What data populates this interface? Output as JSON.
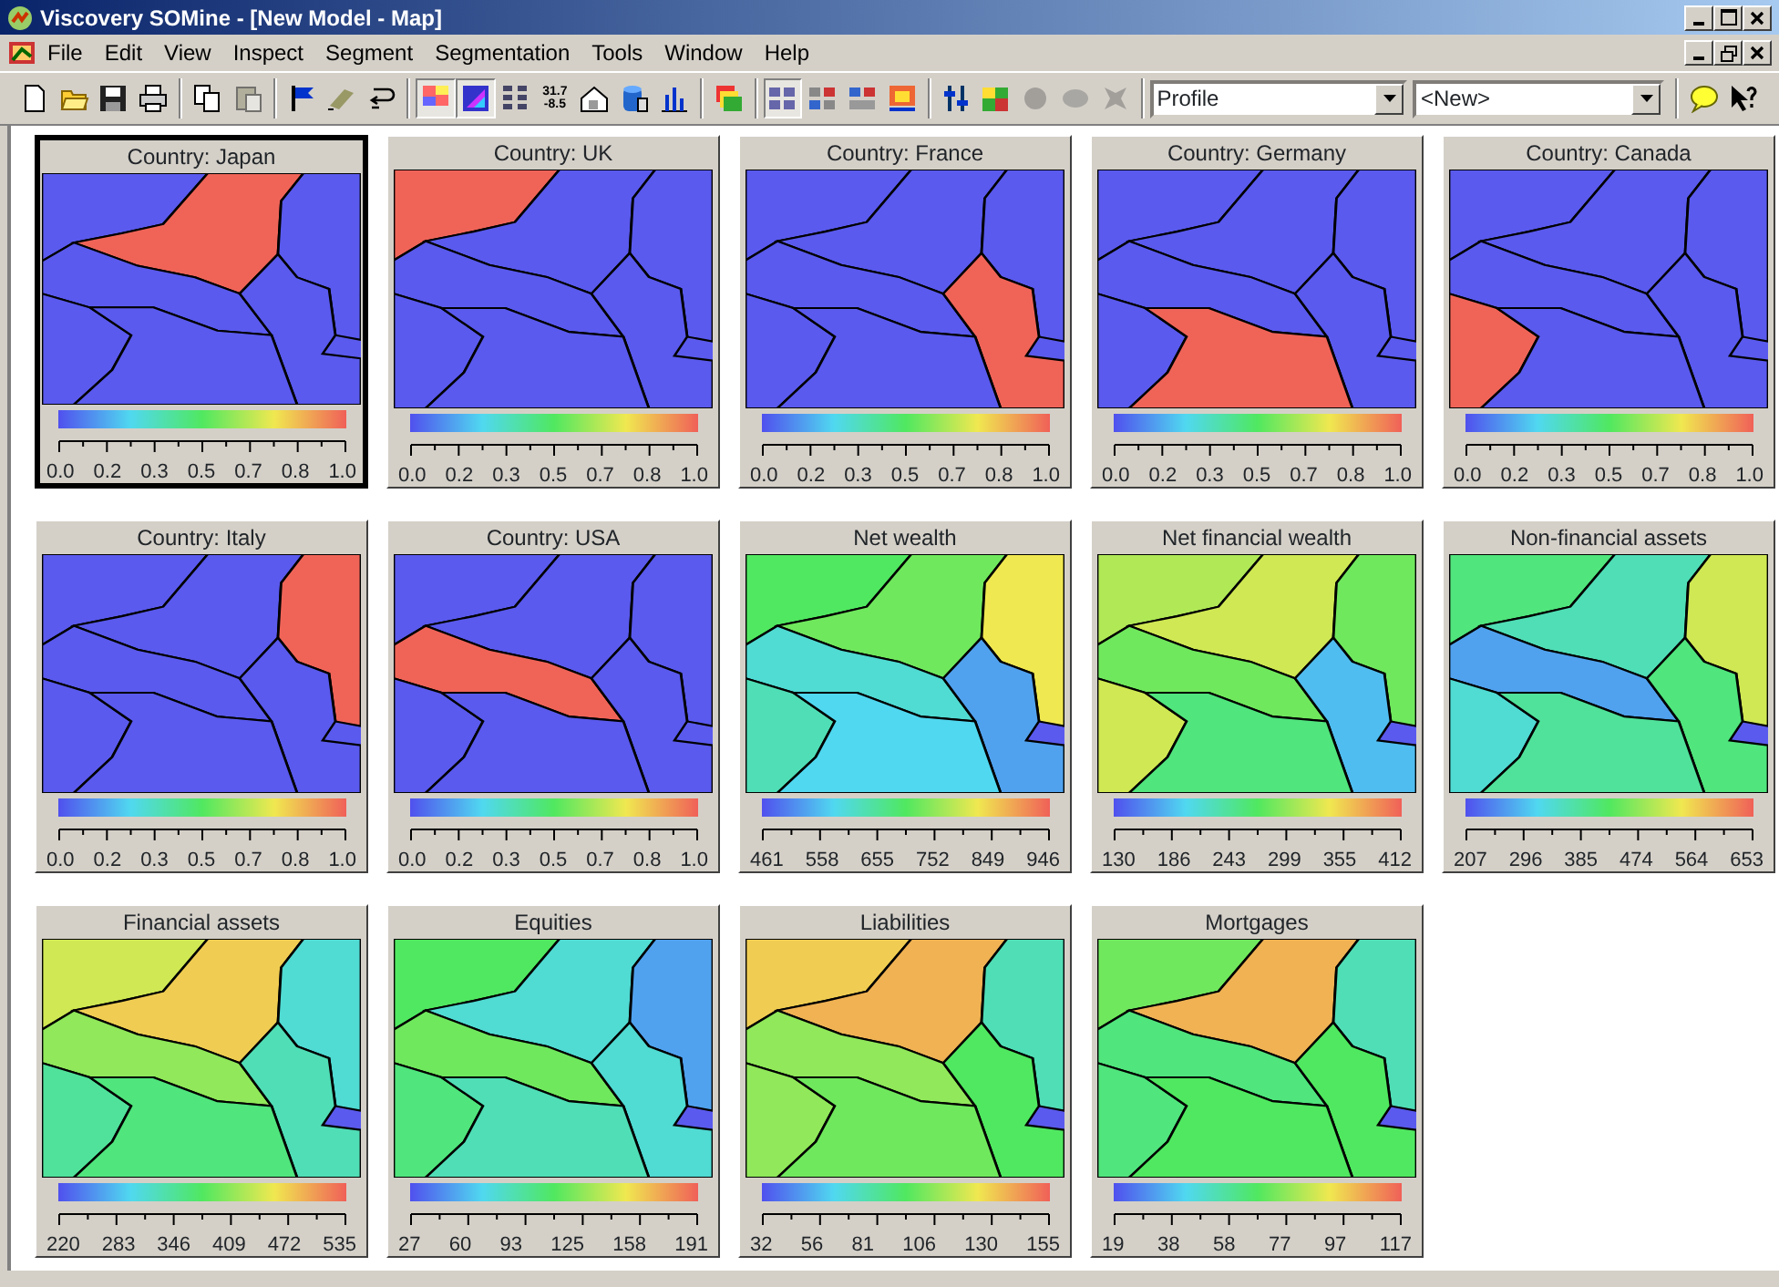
{
  "window": {
    "title": "Viscovery SOMine - [New Model - Map]"
  },
  "menu": [
    {
      "label": "File"
    },
    {
      "label": "Edit"
    },
    {
      "label": "View"
    },
    {
      "label": "Inspect"
    },
    {
      "label": "Segment"
    },
    {
      "label": "Segmentation"
    },
    {
      "label": "Tools"
    },
    {
      "label": "Window"
    },
    {
      "label": "Help"
    }
  ],
  "toolbar": {
    "groups": [
      [
        {
          "pressed": false,
          "disabled": false
        },
        {
          "pressed": false,
          "disabled": false
        },
        {
          "pressed": false,
          "disabled": false
        },
        {
          "pressed": false,
          "disabled": false
        }
      ],
      [
        {
          "pressed": false,
          "disabled": false
        },
        {
          "pressed": false,
          "disabled": true
        }
      ],
      [
        {
          "pressed": false,
          "disabled": false
        },
        {
          "pressed": false,
          "disabled": false
        },
        {
          "pressed": false,
          "disabled": false
        }
      ],
      [
        {
          "pressed": true,
          "disabled": false
        },
        {
          "pressed": true,
          "disabled": false
        },
        {
          "pressed": false,
          "disabled": false
        },
        {
          "pressed": false,
          "disabled": false,
          "text_lines": [
            "31.7",
            "-8.5"
          ]
        },
        {
          "pressed": false,
          "disabled": false
        },
        {
          "pressed": false,
          "disabled": false
        },
        {
          "pressed": false,
          "disabled": false
        }
      ],
      [
        {
          "pressed": false,
          "disabled": false
        }
      ],
      [
        {
          "pressed": true,
          "disabled": false
        },
        {
          "pressed": false,
          "disabled": false
        },
        {
          "pressed": false,
          "disabled": false
        },
        {
          "pressed": false,
          "disabled": false
        }
      ],
      [
        {
          "pressed": false,
          "disabled": false
        },
        {
          "pressed": false,
          "disabled": false
        },
        {
          "pressed": false,
          "disabled": true
        },
        {
          "pressed": false,
          "disabled": true
        },
        {
          "pressed": false,
          "disabled": true
        }
      ]
    ],
    "combos": [
      {
        "value": "Profile"
      },
      {
        "value": "<New>"
      }
    ]
  },
  "maps": [
    {
      "title": "Country: Japan",
      "selected": true,
      "ticks": [
        "0.0",
        "0.2",
        "0.3",
        "0.5",
        "0.7",
        "0.8",
        "1.0"
      ]
    },
    {
      "title": "Country: UK",
      "selected": false,
      "ticks": [
        "0.0",
        "0.2",
        "0.3",
        "0.5",
        "0.7",
        "0.8",
        "1.0"
      ]
    },
    {
      "title": "Country: France",
      "selected": false,
      "ticks": [
        "0.0",
        "0.2",
        "0.3",
        "0.5",
        "0.7",
        "0.8",
        "1.0"
      ]
    },
    {
      "title": "Country: Germany",
      "selected": false,
      "ticks": [
        "0.0",
        "0.2",
        "0.3",
        "0.5",
        "0.7",
        "0.8",
        "1.0"
      ]
    },
    {
      "title": "Country: Canada",
      "selected": false,
      "ticks": [
        "0.0",
        "0.2",
        "0.3",
        "0.5",
        "0.7",
        "0.8",
        "1.0"
      ]
    },
    {
      "title": "Country: Italy",
      "selected": false,
      "ticks": [
        "0.0",
        "0.2",
        "0.3",
        "0.5",
        "0.7",
        "0.8",
        "1.0"
      ]
    },
    {
      "title": "Country: USA",
      "selected": false,
      "ticks": [
        "0.0",
        "0.2",
        "0.3",
        "0.5",
        "0.7",
        "0.8",
        "1.0"
      ]
    },
    {
      "title": "Net wealth",
      "selected": false,
      "ticks": [
        "461",
        "558",
        "655",
        "752",
        "849",
        "946"
      ]
    },
    {
      "title": "Net financial wealth",
      "selected": false,
      "ticks": [
        "130",
        "186",
        "243",
        "299",
        "355",
        "412"
      ]
    },
    {
      "title": "Non-financial assets",
      "selected": false,
      "ticks": [
        "207",
        "296",
        "385",
        "474",
        "564",
        "653"
      ]
    },
    {
      "title": "Financial assets",
      "selected": false,
      "ticks": [
        "220",
        "283",
        "346",
        "409",
        "472",
        "535"
      ]
    },
    {
      "title": "Equities",
      "selected": false,
      "ticks": [
        "27",
        "60",
        "93",
        "125",
        "158",
        "191"
      ]
    },
    {
      "title": "Liabilities",
      "selected": false,
      "ticks": [
        "32",
        "56",
        "81",
        "106",
        "130",
        "155"
      ]
    },
    {
      "title": "Mortgages",
      "selected": false,
      "ticks": [
        "19",
        "38",
        "58",
        "77",
        "97",
        "117"
      ]
    }
  ]
}
